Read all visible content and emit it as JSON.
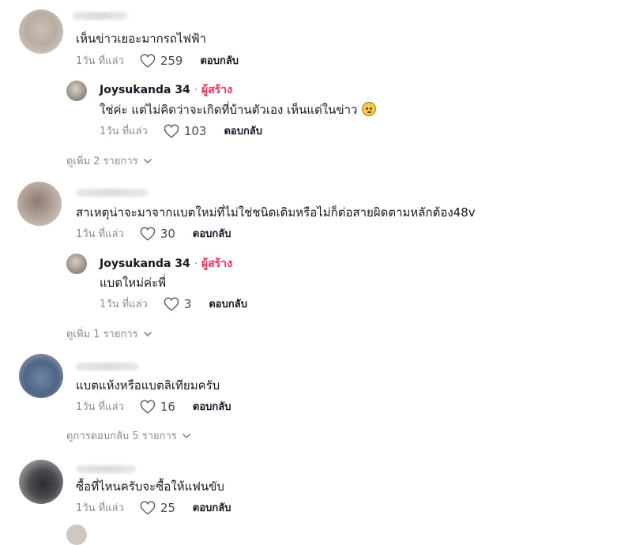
{
  "threads": [
    {
      "comment": "เห็นข่าวเยอะมากรถไฟฟ้า",
      "time": "1วัน ที่แล่ว",
      "likes": "259",
      "reply_label": "ตอบกลับ",
      "reply": {
        "author": "Joysukanda 34",
        "separator": "·",
        "creator_badge": "ผู้สร้าง",
        "comment": "ใช่ค่ะ แต่ไม่คิดว่าจะเกิดที่บ้านตัวเอง เห็นแต่ในข่าว",
        "emoji": "flushed-face-emoji",
        "time": "1วัน ที่แล่ว",
        "likes": "103",
        "reply_label": "ตอบกลับ"
      },
      "more_replies": "ดูเพิ่ม 2 รายการ"
    },
    {
      "comment": "สาเหตุน่าจะมาจากแบตใหม่ที่ไม่ใช่ชนิดเดิมหรือไม่ก็ต่อสายผิดตามหลักต้อง48v",
      "time": "1วัน ที่แล่ว",
      "likes": "30",
      "reply_label": "ตอบกลับ",
      "reply": {
        "author": "Joysukanda 34",
        "separator": "·",
        "creator_badge": "ผู้สร้าง",
        "comment": "แบตใหม่ค่ะพี่",
        "time": "1วัน ที่แล่ว",
        "likes": "3",
        "reply_label": "ตอบกลับ"
      },
      "more_replies": "ดูเพิ่ม 1 รายการ"
    },
    {
      "comment": "แบตแห้งหรือแบตลิเทียมครับ",
      "time": "1วัน ที่แล่ว",
      "likes": "16",
      "reply_label": "ตอบกลับ",
      "more_replies": "ดูการตอบกลับ 5 รายการ"
    },
    {
      "comment": "ซื้อที่ไหนครับจะซื้อให้แฟนขับ",
      "time": "1วัน ที่แล่ว",
      "likes": "25",
      "reply_label": "ตอบกลับ"
    }
  ],
  "colors": {
    "text": "#161823",
    "secondary": "#8a8b91",
    "creator": "#fe2c55"
  },
  "icons": {
    "like": "heart-outline-icon",
    "expand": "chevron-down-icon"
  }
}
